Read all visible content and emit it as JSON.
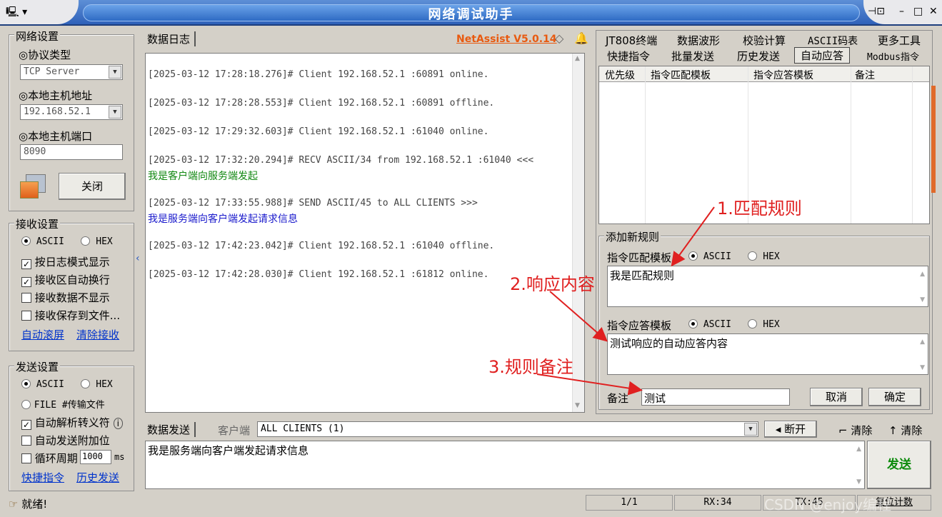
{
  "window": {
    "title": "网络调试助手"
  },
  "network": {
    "group_title": "网络设置",
    "protocol_label": "◎协议类型",
    "protocol_value": "TCP Server",
    "host_label": "◎本地主机地址",
    "host_value": "192.168.52.1",
    "port_label": "◎本地主机端口",
    "port_value": "8090",
    "close_button": "关闭"
  },
  "receive": {
    "group_title": "接收设置",
    "ascii": "ASCII",
    "hex": "HEX",
    "opt_log_mode": "按日志模式显示",
    "opt_auto_wrap": "接收区自动换行",
    "opt_hide": "接收数据不显示",
    "opt_save_file": "接收保存到文件...",
    "link_auto_scroll": "自动滚屏",
    "link_clear": "清除接收"
  },
  "send": {
    "group_title": "发送设置",
    "ascii": "ASCII",
    "hex": "HEX",
    "opt_file": "FILE #传输文件",
    "opt_escape": "自动解析转义符",
    "opt_append": "自动发送附加位",
    "opt_cycle": "循环周期",
    "cycle_value": "1000",
    "cycle_unit": "ms",
    "link_shortcut": "快捷指令",
    "link_history": "历史发送"
  },
  "log": {
    "tab": "数据日志",
    "brand": "NetAssist V5.0.14",
    "lines": [
      {
        "text": "[2025-03-12 17:28:18.276]# Client 192.168.52.1 :60891 online.",
        "color": "#444444"
      },
      {
        "text": "[2025-03-12 17:28:28.553]# Client 192.168.52.1 :60891 offline.",
        "color": "#444444"
      },
      {
        "text": "[2025-03-12 17:29:32.603]# Client 192.168.52.1 :61040 online.",
        "color": "#444444"
      },
      {
        "text": "[2025-03-12 17:32:20.294]# RECV ASCII/34 from 192.168.52.1 :61040 <<<",
        "color": "#444444"
      },
      {
        "text": "我是客户端向服务端发起",
        "color": "#118811"
      },
      {
        "text": "[2025-03-12 17:33:55.988]# SEND ASCII/45 to ALL CLIENTS >>>",
        "color": "#444444"
      },
      {
        "text": "我是服务端向客户端发起请求信息",
        "color": "#1a1acc"
      },
      {
        "text": "[2025-03-12 17:42:23.042]# Client 192.168.52.1 :61040 offline.",
        "color": "#444444"
      },
      {
        "text": "[2025-03-12 17:42:28.030]# Client 192.168.52.1 :61812 online.",
        "color": "#444444"
      }
    ]
  },
  "right_tabs": {
    "row1": [
      "JT808终端",
      "数据波形",
      "校验计算",
      "ASCII码表",
      "更多工具"
    ],
    "row2": [
      "快捷指令",
      "批量发送",
      "历史发送",
      "自动应答",
      "Modbus指令"
    ],
    "active": "自动应答"
  },
  "rule_table": {
    "headers": [
      "优先级",
      "指令匹配模板",
      "指令应答模板",
      "备注"
    ]
  },
  "new_rule": {
    "group_title": "添加新规则",
    "match_label": "指令匹配模板",
    "match_ascii": "ASCII",
    "match_hex": "HEX",
    "match_value": "我是匹配规则",
    "reply_label": "指令应答模板",
    "reply_ascii": "ASCII",
    "reply_hex": "HEX",
    "reply_value": "测试响应的自动应答内容",
    "remark_label": "备注",
    "remark_value": "测试",
    "cancel": "取消",
    "confirm": "确定"
  },
  "annotations": {
    "a1": "1.匹配规则",
    "a2": "2.响应内容",
    "a3": "3.规则备注"
  },
  "send_panel": {
    "tab": "数据发送",
    "client_label": "客户端",
    "client_value": "ALL CLIENTS (1)",
    "disconnect": "断开",
    "clear1": "清除",
    "clear2": "清除",
    "content": "我是服务端向客户端发起请求信息",
    "send_button": "发送"
  },
  "statusbar": {
    "ready": "就绪!",
    "page": "1/1",
    "rx": "RX:34",
    "tx": "TX:45",
    "reset": "复位计数",
    "watermark": "CSDN @enjoy编程"
  }
}
